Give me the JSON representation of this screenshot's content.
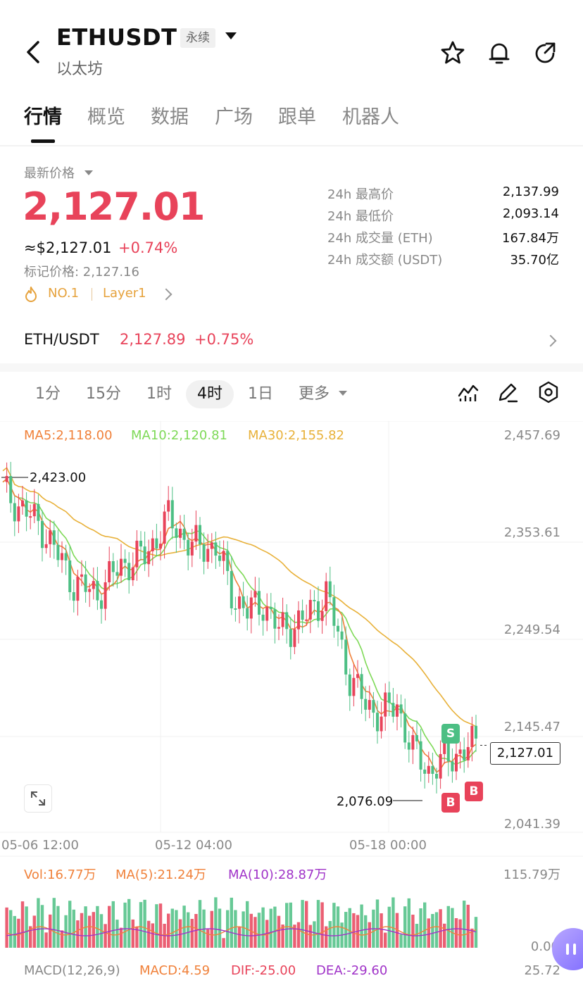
{
  "header": {
    "title": "ETHUSDT",
    "contract_type": "永续",
    "subtitle": "以太坊"
  },
  "tabs": [
    "行情",
    "概览",
    "数据",
    "广场",
    "跟单",
    "机器人"
  ],
  "price": {
    "latest_label": "最新价格",
    "last": "2,127.01",
    "usd_equiv": "≈$2,127.01",
    "change": "+0.74%",
    "mark_price": "标记价格: 2,127.16",
    "rank_tag": "NO.1",
    "category_tag": "Layer1"
  },
  "stats": [
    {
      "label": "24h 最高价",
      "value": "2,137.99"
    },
    {
      "label": "24h 最低价",
      "value": "2,093.14"
    },
    {
      "label": "24h 成交量 (ETH)",
      "value": "167.84万"
    },
    {
      "label": "24h 成交额 (USDT)",
      "value": "35.70亿"
    }
  ],
  "spot": {
    "pair": "ETH/USDT",
    "price": "2,127.89",
    "change": "+0.75%"
  },
  "timeframes": [
    "1分",
    "15分",
    "1时",
    "4时",
    "1日",
    "更多"
  ],
  "active_timeframe": "4时",
  "indicators": {
    "ma5": "MA5:2,118.00",
    "ma10": "MA10:2,120.81",
    "ma30": "MA30:2,155.82"
  },
  "price_axis": [
    "2,457.69",
    "2,353.61",
    "2,249.54",
    "2,145.47",
    "2,041.39"
  ],
  "date_axis": [
    "05-06 12:00",
    "05-12 04:00",
    "05-18 00:00"
  ],
  "annotations": {
    "high": "2,423.00",
    "low": "2,076.09",
    "current": "2,127.01"
  },
  "trade_badges": {
    "sell": "S",
    "buy": "B"
  },
  "volume": {
    "vol": "Vol:16.77万",
    "ma5": "MA(5):21.24万",
    "ma10": "MA(10):28.87万",
    "axis_top": "115.79万",
    "axis_zero": "0.00"
  },
  "macd": {
    "label": "MACD(12,26,9)",
    "macd": "MACD:4.59",
    "dif": "DIF:-25.00",
    "dea": "DEA:-29.60",
    "axis": "25.72"
  },
  "colors": {
    "up": "#e8435a",
    "down": "#4cbf84",
    "ma5": "#f0813a",
    "ma10": "#7ed957",
    "ma30": "#e8b13a",
    "vol_ma10": "#a033c8"
  }
}
